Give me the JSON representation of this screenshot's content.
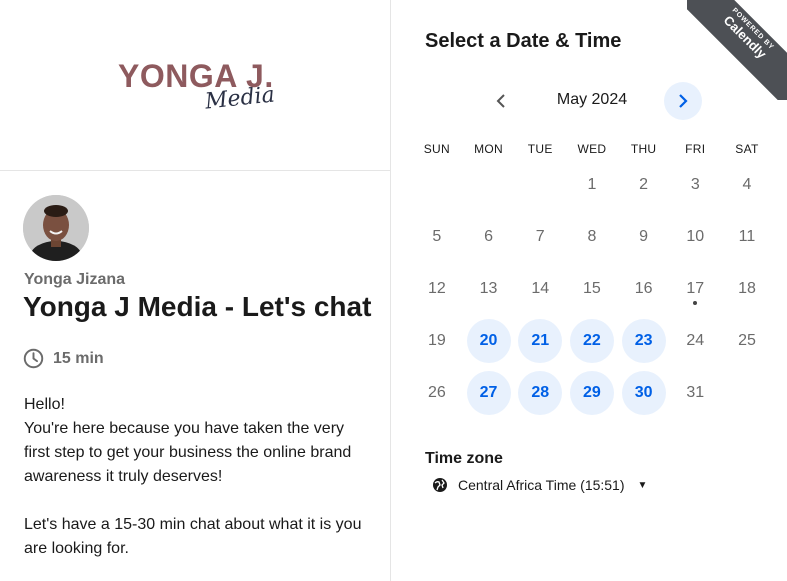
{
  "brand": {
    "logo_main": "YONGA J.",
    "logo_script": "Media",
    "logo_color": "#8e5a5e"
  },
  "host": {
    "name": "Yonga Jizana",
    "avatar": "host-photo"
  },
  "event": {
    "title": "Yonga J Media - Let's chat",
    "duration": "15 min",
    "description": [
      "Hello!",
      "You're here because you have taken the very first step to get your business the online brand awareness it truly deserves!",
      "",
      "Let's have a 15-30 min chat about what it is you are looking for."
    ]
  },
  "scheduler": {
    "title": "Select a Date & Time",
    "month": "May 2024",
    "prev_icon": "chevron-left-icon",
    "next_icon": "chevron-right-icon",
    "weekdays": [
      "SUN",
      "MON",
      "TUE",
      "WED",
      "THU",
      "FRI",
      "SAT"
    ],
    "first_weekday_index": 3,
    "days_in_month": 31,
    "available_days": [
      20,
      21,
      22,
      23,
      27,
      28,
      29,
      30
    ],
    "today": 17,
    "accent_color": "#0060e6",
    "available_bg": "#e8f1fd"
  },
  "timezone": {
    "label": "Time zone",
    "value": "Central Africa Time (15:51)",
    "icon": "globe-icon"
  },
  "ribbon": {
    "by": "POWERED BY",
    "brand": "Calendly"
  }
}
